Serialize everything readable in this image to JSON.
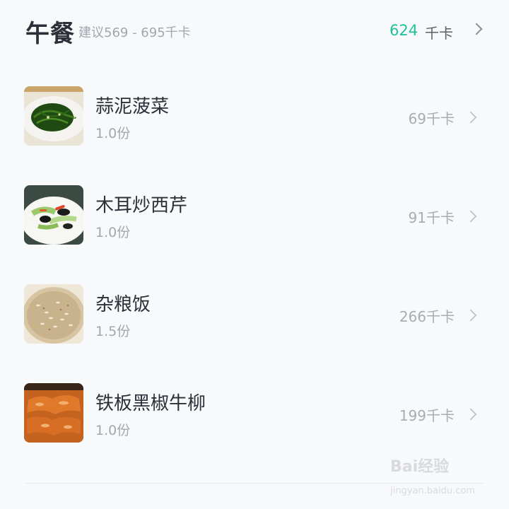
{
  "meal": {
    "title": "午餐",
    "suggestion": "建议569 - 695千卡",
    "total_kcal": "624",
    "unit": "千卡"
  },
  "items": [
    {
      "name": "蒜泥菠菜",
      "portion": "1.0份",
      "kcal": "69千卡"
    },
    {
      "name": "木耳炒西芹",
      "portion": "1.0份",
      "kcal": "91千卡"
    },
    {
      "name": "杂粮饭",
      "portion": "1.5份",
      "kcal": "266千卡"
    },
    {
      "name": "铁板黑椒牛柳",
      "portion": "1.0份",
      "kcal": "199千卡"
    }
  ],
  "watermark": {
    "brand": "Bai经验",
    "url": "jingyan.baidu.com"
  },
  "icons": {
    "chevron": "chevron-right-icon"
  },
  "colors": {
    "accent": "#1fbf9a",
    "title": "#2b2f38",
    "muted": "#a2a6ae"
  }
}
